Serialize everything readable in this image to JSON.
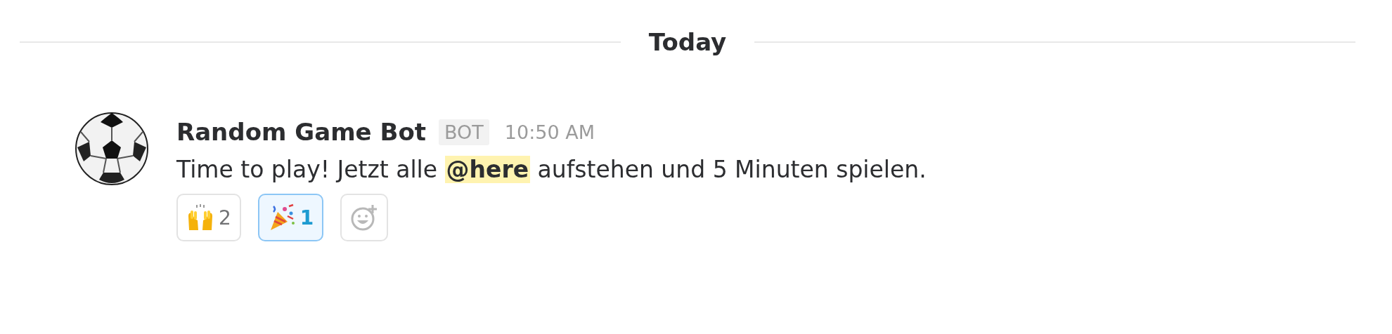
{
  "divider": {
    "label": "Today"
  },
  "message": {
    "author": "Random Game Bot",
    "badge": "BOT",
    "time": "10:50 AM",
    "body": [
      {
        "kind": "text",
        "text": "Time to play! Jetzt alle "
      },
      {
        "kind": "mention",
        "text": "@here"
      },
      {
        "kind": "text",
        "text": " aufstehen und 5 Minuten spielen."
      }
    ],
    "reactions": [
      {
        "kind": "raised-hands",
        "count": "2",
        "selected": false
      },
      {
        "kind": "party-popper",
        "count": "1",
        "selected": true
      },
      {
        "kind": "add"
      }
    ]
  }
}
